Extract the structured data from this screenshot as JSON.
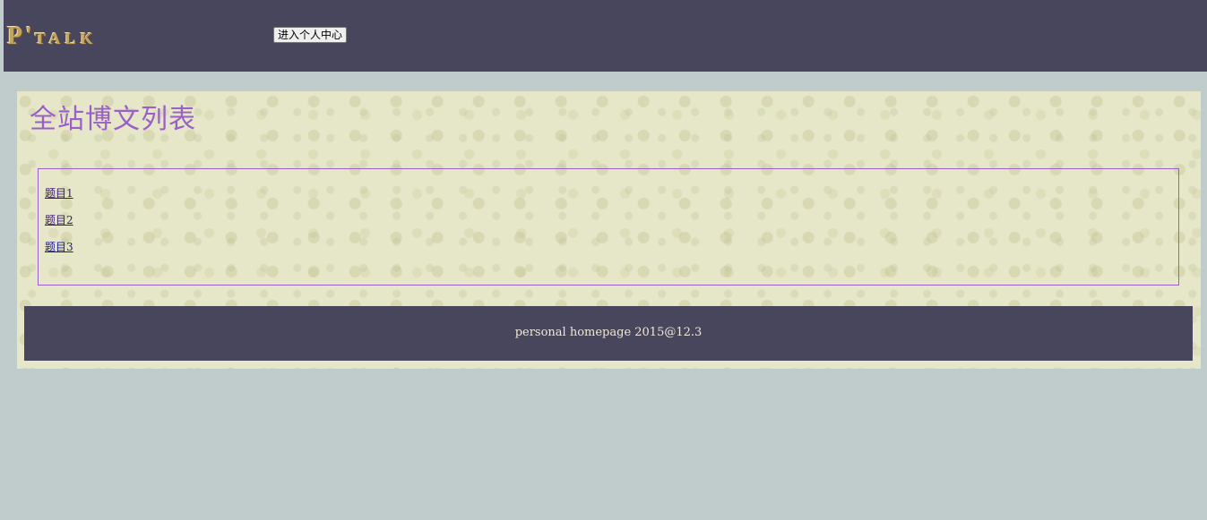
{
  "header": {
    "logo_text": "P'",
    "logo_small": "TALK",
    "nav_button_label": "进入个人中心"
  },
  "main": {
    "title": "全站博文列表",
    "posts": [
      {
        "title": "题目1"
      },
      {
        "title": "题目2"
      },
      {
        "title": "题目3"
      }
    ]
  },
  "footer": {
    "text": "personal homepage 2015@12.3"
  },
  "colors": {
    "header_bg": "#48465c",
    "page_bg": "#c0cccc",
    "accent": "#9a5fc8"
  }
}
